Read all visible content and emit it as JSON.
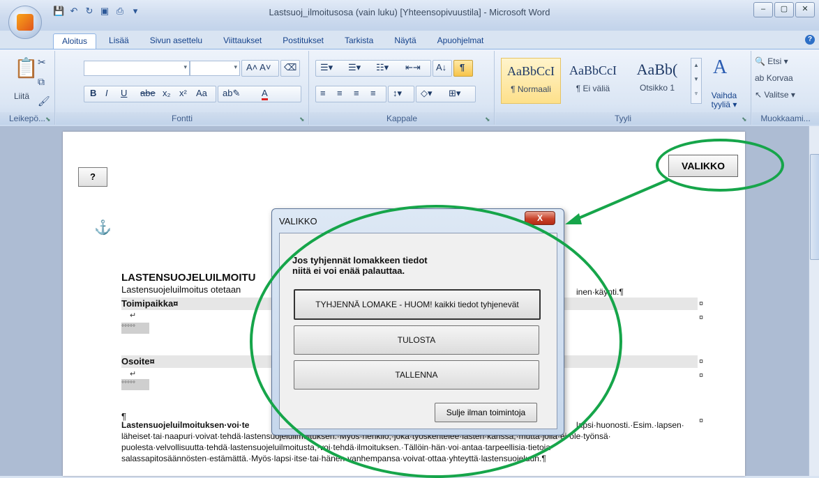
{
  "window": {
    "title": "Lastsuoj_ilmoitusosa (vain luku) [Yhteensopivuustila] - Microsoft Word",
    "controls": [
      "–",
      "▢",
      "✕"
    ]
  },
  "ribbon": {
    "tabs": [
      "Aloitus",
      "Lisää",
      "Sivun asettelu",
      "Viittaukset",
      "Postitukset",
      "Tarkista",
      "Näytä",
      "Apuohjelmat"
    ],
    "active_tab": "Aloitus",
    "groups": {
      "clipboard": {
        "label": "Leikepö...",
        "paste": "Liitä"
      },
      "font": {
        "label": "Fontti"
      },
      "paragraph": {
        "label": "Kappale"
      },
      "styles": {
        "label": "Tyyli",
        "items": [
          {
            "sample": "AaBbCcI",
            "name": "¶ Normaali"
          },
          {
            "sample": "AaBbCcI",
            "name": "¶ Ei väliä"
          },
          {
            "sample": "AaBb(",
            "name": "Otsikko 1"
          }
        ],
        "change": "Vaihda tyyliä ▾"
      },
      "editing": {
        "label": "Muokkaami...",
        "find": "Etsi ▾",
        "replace": "Korvaa",
        "select": "Valitse ▾"
      }
    }
  },
  "document": {
    "help_button": "?",
    "menu_button": "VALIKKO",
    "heading": "LASTENSUOJELUILMOITU",
    "intro_left": "Lastensuojeluilmoitus otetaan",
    "intro_right": "inen·käynti.¶",
    "field1_label": "Toimipaikka¤",
    "field2_label": "Osoite¤",
    "field_placeholder": "°°°°°",
    "pilcrow": "¶",
    "cell_mark": "¤",
    "para_bold": "Lastensuojeluilmoituksen·voi·te",
    "para_line1_end": "lapsi·huonosti.·Esim.·lapsen·",
    "para_line2": "läheiset·tai·naapuri·voivat·tehdä·lastensuojeluilmoituksen.·Myös·henkilö,·joka·työskentelee·lasten·kanssa,·mutta·jolla·ei·ole·työnsä·",
    "para_line3": "puolesta·velvollisuutta·tehdä·lastensuojeluilmoitusta,·voi·tehdä·ilmoituksen.·Tällöin·hän·voi·antaa·tarpeellisia·tietoja·",
    "para_line4": "salassapitosäännösten·estämättä.·Myös·lapsi·itse·tai·hänen·vanhempansa·voivat·ottaa·yhteyttä·lastensuojeluun.¶"
  },
  "dialog": {
    "title": "VALIKKO",
    "close": "X",
    "message_line1": "Jos tyhjennät lomakkeen tiedot",
    "message_line2": "niitä ei voi enää palauttaa.",
    "buttons": [
      "TYHJENNÄ LOMAKE - HUOM! kaikki tiedot tyhjenevät",
      "TULOSTA",
      "TALLENNA"
    ],
    "close_button": "Sulje ilman toimintoja"
  },
  "colors": {
    "annotation": "#16a54a",
    "ribbon": "#dbe6f4",
    "dialog_close": "#c8432b"
  }
}
